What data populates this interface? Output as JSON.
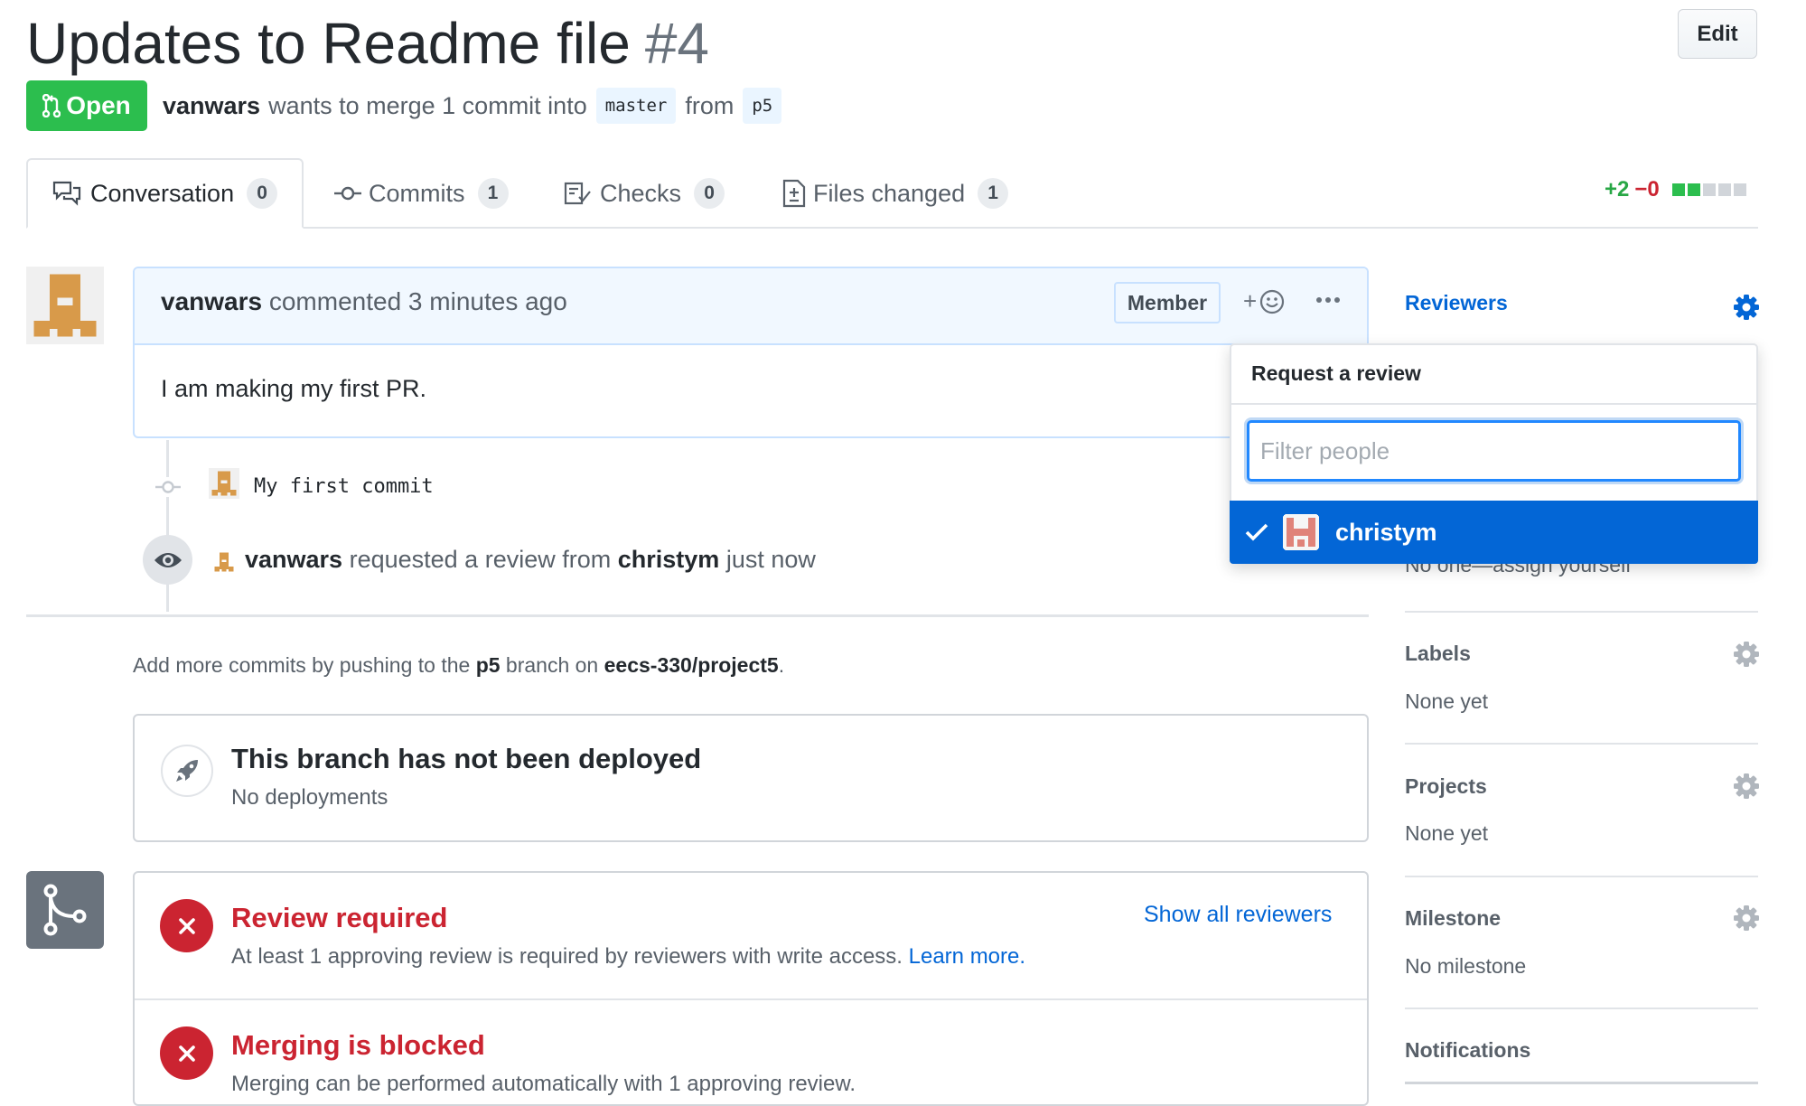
{
  "pr": {
    "title": "Updates to Readme file",
    "number": "#4",
    "edit_label": "Edit",
    "state": "Open",
    "author": "vanwars",
    "merge_text": "wants to merge 1 commit into",
    "base_branch": "master",
    "from_text": "from",
    "head_branch": "p5"
  },
  "tabs": [
    {
      "label": "Conversation",
      "count": "0",
      "icon": "comment-discussion-icon"
    },
    {
      "label": "Commits",
      "count": "1",
      "icon": "git-commit-icon"
    },
    {
      "label": "Checks",
      "count": "0",
      "icon": "checklist-icon"
    },
    {
      "label": "Files changed",
      "count": "1",
      "icon": "file-diff-icon"
    }
  ],
  "diffstat": {
    "additions": "+2",
    "deletions": "−0",
    "colors": [
      "#2cbe4e",
      "#2cbe4e",
      "#d1d5da",
      "#d1d5da",
      "#d1d5da"
    ]
  },
  "comment": {
    "author": "vanwars",
    "meta": "commented 3 minutes ago",
    "badge": "Member",
    "body": "I am making my first PR."
  },
  "timeline": {
    "commit_message": "My first commit",
    "review_actor": "vanwars",
    "review_text": "requested a review from",
    "review_target": "christym",
    "review_time": "just now"
  },
  "push_hint": {
    "prefix": "Add more commits by pushing to the",
    "branch": "p5",
    "middle": "branch on",
    "repo": "eecs-330/project5",
    "suffix": "."
  },
  "deploy": {
    "title": "This branch has not been deployed",
    "subtitle": "No deployments"
  },
  "merge_status": {
    "review_title": "Review required",
    "review_text": "At least 1 approving review is required by reviewers with write access.",
    "learn_more": "Learn more.",
    "show_all": "Show all reviewers",
    "blocked_title": "Merging is blocked",
    "blocked_text": "Merging can be performed automatically with 1 approving review."
  },
  "sidebar": {
    "reviewers": "Reviewers",
    "assignees_value": "No one—assign yourself",
    "labels": "Labels",
    "labels_value": "None yet",
    "projects": "Projects",
    "projects_value": "None yet",
    "milestone": "Milestone",
    "milestone_value": "No milestone",
    "notifications": "Notifications"
  },
  "review_menu": {
    "title": "Request a review",
    "filter_placeholder": "Filter people",
    "items": [
      {
        "name": "christym",
        "selected": true
      }
    ]
  },
  "colors": {
    "open_green": "#2cbe4e",
    "link_blue": "#0366d6",
    "error_red": "#cb2431",
    "selected_bg": "#0366d6",
    "avatar_vanwars": "#d89a4a",
    "avatar_christym": "#e0837a"
  }
}
